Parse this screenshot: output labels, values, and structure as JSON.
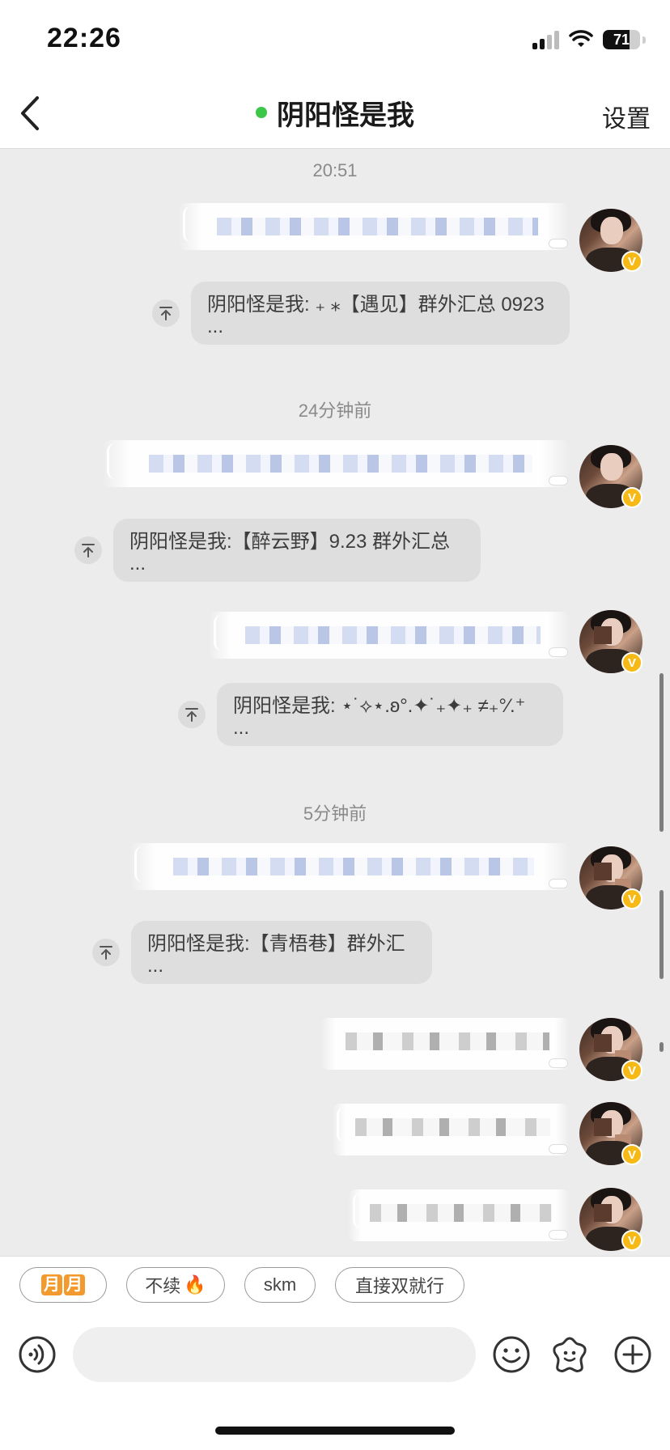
{
  "status_bar": {
    "time": "22:26",
    "battery": "71"
  },
  "header": {
    "title": "阴阳怪是我",
    "settings_label": "设置"
  },
  "chat": {
    "groups": [
      {
        "time": "20:51",
        "message": "阴阳怪是我: ₊ ⁎【遇见】群外汇总 0923",
        "ellipsis": "..."
      },
      {
        "time": "24分钟前",
        "message": "阴阳怪是我:【醉云野】9.23 群外汇总",
        "ellipsis": "..."
      },
      {
        "time": "",
        "message": "阴阳怪是我: ⋆˙⟡⋆.ʚ°.✦˙₊✦₊ ≠₊°⁄.⁺",
        "ellipsis": "..."
      },
      {
        "time": "5分钟前",
        "message": "阴阳怪是我:【青梧巷】群外汇",
        "ellipsis": "..."
      }
    ]
  },
  "quick_replies": [
    {
      "label": "月月"
    },
    {
      "label": "不续"
    },
    {
      "label": "skm"
    },
    {
      "label": "直接双就行"
    }
  ],
  "quick_reply_tags": [
    "月",
    "月"
  ],
  "input": {
    "placeholder": ""
  },
  "badge": {
    "verified_text": "V"
  },
  "colors": {
    "online": "#3cc74a",
    "badge": "#f6b915",
    "tag": "#f29a2e"
  },
  "icons": [
    "back-icon",
    "voice-icon",
    "emoji-icon",
    "sticker-icon",
    "plus-icon",
    "pin-top-icon",
    "fire-icon"
  ]
}
